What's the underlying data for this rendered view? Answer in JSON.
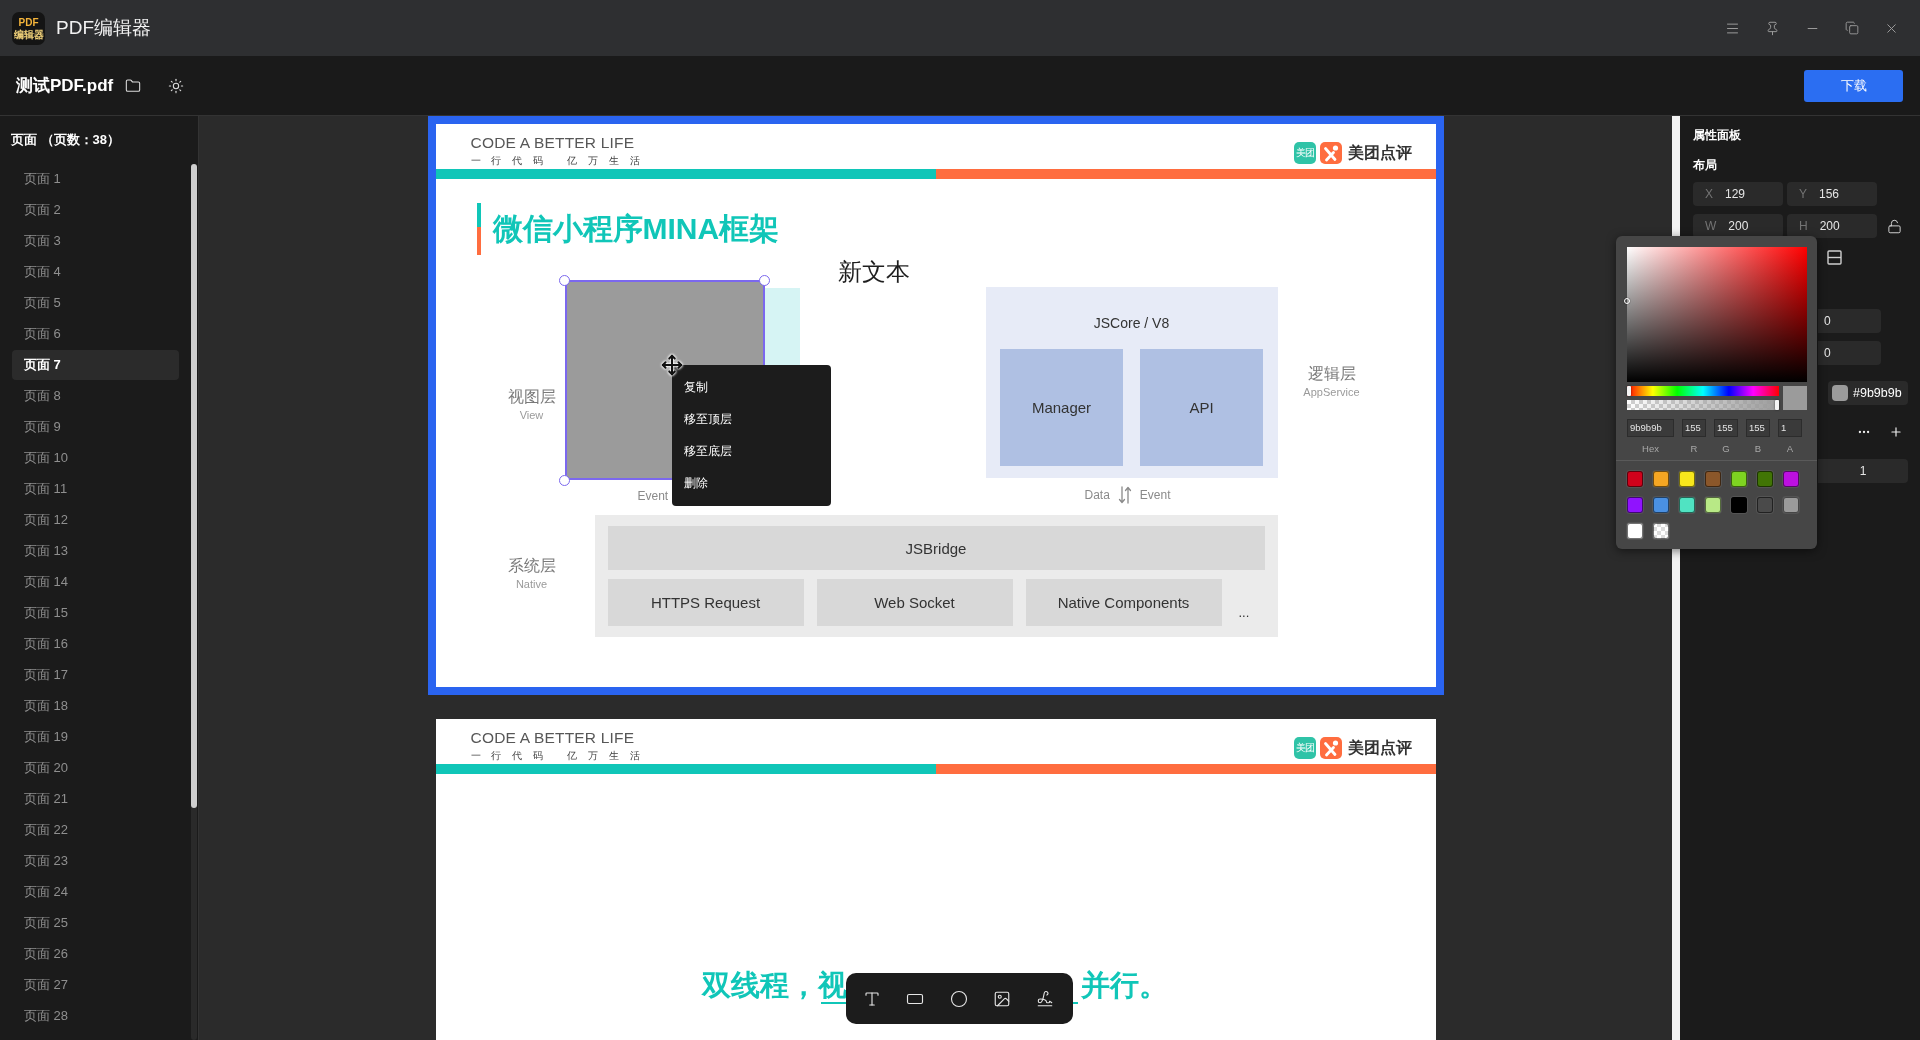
{
  "title_bar": {
    "app_logo": [
      "PDF",
      "编辑器"
    ],
    "title": "PDF编辑器"
  },
  "toolbar": {
    "file_name": "测试PDF.pdf",
    "download_button": "下载"
  },
  "sidebar": {
    "header": "页面 （页数：38）",
    "items": [
      {
        "label": "页面 1",
        "selected": false
      },
      {
        "label": "页面 2",
        "selected": false
      },
      {
        "label": "页面 3",
        "selected": false
      },
      {
        "label": "页面 4",
        "selected": false
      },
      {
        "label": "页面 5",
        "selected": false
      },
      {
        "label": "页面 6",
        "selected": false
      },
      {
        "label": "页面 7",
        "selected": true
      },
      {
        "label": "页面 8",
        "selected": false
      },
      {
        "label": "页面 9",
        "selected": false
      },
      {
        "label": "页面 10",
        "selected": false
      },
      {
        "label": "页面 11",
        "selected": false
      },
      {
        "label": "页面 12",
        "selected": false
      },
      {
        "label": "页面 13",
        "selected": false
      },
      {
        "label": "页面 14",
        "selected": false
      },
      {
        "label": "页面 15",
        "selected": false
      },
      {
        "label": "页面 16",
        "selected": false
      },
      {
        "label": "页面 17",
        "selected": false
      },
      {
        "label": "页面 18",
        "selected": false
      },
      {
        "label": "页面 19",
        "selected": false
      },
      {
        "label": "页面 20",
        "selected": false
      },
      {
        "label": "页面 21",
        "selected": false
      },
      {
        "label": "页面 22",
        "selected": false
      },
      {
        "label": "页面 23",
        "selected": false
      },
      {
        "label": "页面 24",
        "selected": false
      },
      {
        "label": "页面 25",
        "selected": false
      },
      {
        "label": "页面 26",
        "selected": false
      },
      {
        "label": "页面 27",
        "selected": false
      },
      {
        "label": "页面 28",
        "selected": false
      }
    ]
  },
  "canvas": {
    "pages": [
      {
        "kind": "diagram",
        "selected": true,
        "header": {
          "tagline": "CODE A BETTER LIFE",
          "motto": "一行代码 亿万生活",
          "logo_tile": "美团",
          "logo_text": "美团点评"
        },
        "title": "微信小程序MINA框架",
        "text_box": "新文本",
        "view_layer": {
          "label": "视图层",
          "sublabel": "View",
          "event_label": "Event"
        },
        "logic_layer": {
          "label": "逻辑层",
          "sublabel": "AppService",
          "engine": "JSCore / V8",
          "modules": [
            "Manager",
            "API"
          ],
          "data_label": "Data",
          "event_label": "Event"
        },
        "system_layer": {
          "label": "系统层",
          "sublabel": "Native",
          "bridge": "JSBridge",
          "modules": [
            "HTTPS Request",
            "Web Socket",
            "Native Components"
          ],
          "more": "..."
        },
        "context_menu": [
          "复制",
          "移至顶层",
          "移至底层",
          "删除"
        ]
      },
      {
        "kind": "headline",
        "selected": false,
        "header": {
          "tagline": "CODE A BETTER LIFE",
          "motto": "一行代码 亿万生活",
          "logo_tile": "美团",
          "logo_text": "美团点评"
        },
        "headline": [
          "双线程，视",
          "并行。"
        ]
      }
    ]
  },
  "properties_panel": {
    "title": "属性面板",
    "section": "布局",
    "geometry": [
      {
        "label": "X",
        "value": "129"
      },
      {
        "label": "Y",
        "value": "156"
      },
      {
        "label": "W",
        "value": "200"
      },
      {
        "label": "H",
        "value": "200"
      }
    ],
    "aspect_locked": false,
    "fields": [
      {
        "value": "0"
      },
      {
        "value": "0"
      }
    ],
    "fill_hex": "#9b9b9b",
    "stepper_value": "1"
  },
  "color_picker": {
    "sliders": [
      {
        "kind": "hue",
        "level": 0
      },
      {
        "kind": "alpha",
        "level": 1
      }
    ],
    "inputs": [
      {
        "label": "Hex",
        "value": "9b9b9b"
      },
      {
        "label": "R",
        "value": "155"
      },
      {
        "label": "G",
        "value": "155"
      },
      {
        "label": "B",
        "value": "155"
      },
      {
        "label": "A",
        "value": "1"
      }
    ],
    "presets": [
      {
        "kind": "solid",
        "color": "#d0021b"
      },
      {
        "kind": "solid",
        "color": "#f5a623"
      },
      {
        "kind": "solid",
        "color": "#f8e71c"
      },
      {
        "kind": "solid",
        "color": "#8b572a"
      },
      {
        "kind": "solid",
        "color": "#7ed321"
      },
      {
        "kind": "solid",
        "color": "#417505"
      },
      {
        "kind": "solid",
        "color": "#bd10e0"
      },
      {
        "kind": "solid",
        "color": "#9013fe"
      },
      {
        "kind": "solid",
        "color": "#4a90e2"
      },
      {
        "kind": "solid",
        "color": "#50e3c2"
      },
      {
        "kind": "solid",
        "color": "#b8e986"
      },
      {
        "kind": "solid",
        "color": "#000000"
      },
      {
        "kind": "solid",
        "color": "#4a4a4a"
      },
      {
        "kind": "solid",
        "color": "#9b9b9b"
      },
      {
        "kind": "solid",
        "color": "#ffffff"
      },
      {
        "kind": "transparent"
      }
    ]
  }
}
